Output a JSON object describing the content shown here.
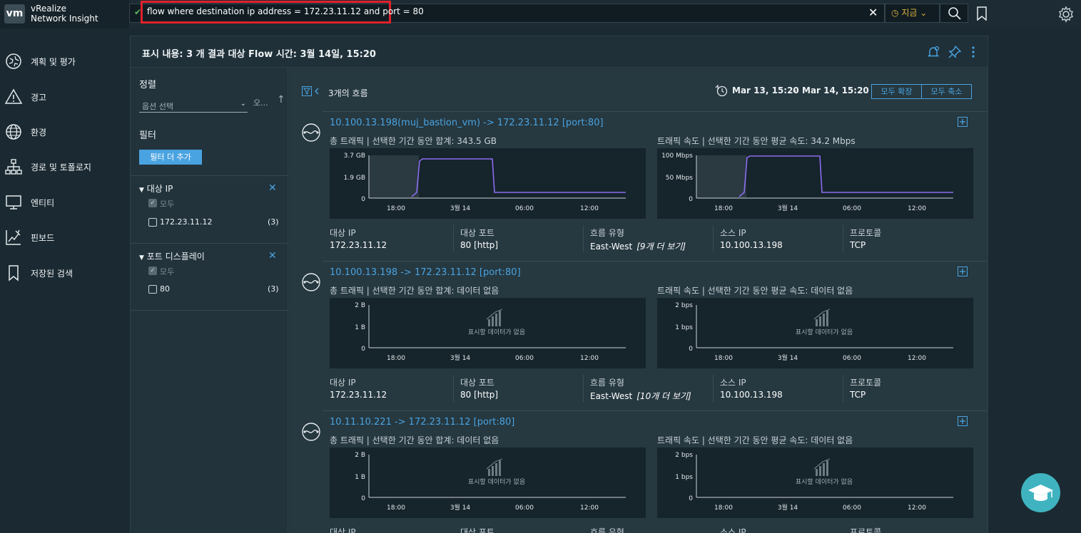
{
  "app": {
    "logo": "vm",
    "name_line1": "vRealize",
    "name_line2": "Network Insight"
  },
  "search": {
    "query": "flow where destination ip address = 172.23.11.12 and port = 80",
    "time_label": "지금"
  },
  "sidebar": {
    "items": [
      {
        "label": "계획 및 평가"
      },
      {
        "label": "경고"
      },
      {
        "label": "환경"
      },
      {
        "label": "경로 및 토폴로지"
      },
      {
        "label": "엔티티"
      },
      {
        "label": "핀보드"
      },
      {
        "label": "저장된 검색"
      }
    ]
  },
  "panel": {
    "title": "표시 내용: 3 개 결과 대상 Flow 시간: 3월 14일, 15:20"
  },
  "filters": {
    "sort_title": "정렬",
    "sort_placeholder": "옵션 선택",
    "sort_order_label": "오...",
    "filter_title": "필터",
    "add_filter_label": "필터 더 추가",
    "facets": [
      {
        "title": "대상 IP",
        "all_label": "모두",
        "value": "172.23.11.12",
        "count": "(3)"
      },
      {
        "title": "포트 디스플레이",
        "all_label": "모두",
        "value": "80",
        "count": "(3)"
      }
    ]
  },
  "results": {
    "count_label": "3개의 흐름",
    "range_start": "Mar 13, 15:20",
    "range_dash": "-",
    "range_end": "Mar 14, 15:20",
    "expand_all": "모두 확장",
    "collapse_all": "모두 축소",
    "x_ticks": [
      "18:00",
      "3월 14",
      "06:00",
      "12:00"
    ],
    "no_data": "표시할 데이터가 없음",
    "meta_labels": [
      "대상 IP",
      "대상 포트",
      "흐름 유형",
      "소스 IP",
      "프로토콜"
    ],
    "flows": [
      {
        "title": "10.100.13.198(muj_bastion_vm) -> 172.23.11.12 [port:80]",
        "traffic_label": "총 트래픽 | 선택한 기간 동안 합계: 343.5 GB",
        "rate_label": "트래픽 속도 | 선택한 기간 동안 평균 속도: 34.2 Mbps",
        "traffic_y_ticks": [
          "3.7 GB",
          "1.9 GB",
          "0"
        ],
        "rate_y_ticks": [
          "100 Mbps",
          "50 Mbps",
          "0"
        ],
        "dst_ip": "172.23.11.12",
        "dst_port": "80 [http]",
        "flow_type": "East-West",
        "flow_type_more": "[9개 더 보기]",
        "src_ip": "10.100.13.198",
        "protocol": "TCP"
      },
      {
        "title": "10.100.13.198 -> 172.23.11.12 [port:80]",
        "traffic_label": "총 트래픽 | 선택한 기간 동안 합계: 데이터 없음",
        "rate_label": "트래픽 속도 | 선택한 기간 동안 평균 속도: 데이터 없음",
        "traffic_y_ticks": [
          "2 B",
          "1 B",
          "0"
        ],
        "rate_y_ticks": [
          "2 bps",
          "1 bps",
          "0"
        ],
        "dst_ip": "172.23.11.12",
        "dst_port": "80 [http]",
        "flow_type": "East-West",
        "flow_type_more": "[10개 더 보기]",
        "src_ip": "10.100.13.198",
        "protocol": "TCP"
      },
      {
        "title": "10.11.10.221 -> 172.23.11.12 [port:80]",
        "traffic_label": "총 트래픽 | 선택한 기간 동안 합계: 데이터 없음",
        "rate_label": "트래픽 속도 | 선택한 기간 동안 평균 속도: 데이터 없음",
        "traffic_y_ticks": [
          "2 B",
          "1 B",
          "0"
        ],
        "rate_y_ticks": [
          "2 bps",
          "1 bps",
          "0"
        ]
      }
    ]
  },
  "colors": {
    "accent": "#49a3e0",
    "series": "#8a6cf0",
    "highlight_border": "#e0212b",
    "time_accent": "#e0b23b",
    "fab": "#40b3c0"
  }
}
